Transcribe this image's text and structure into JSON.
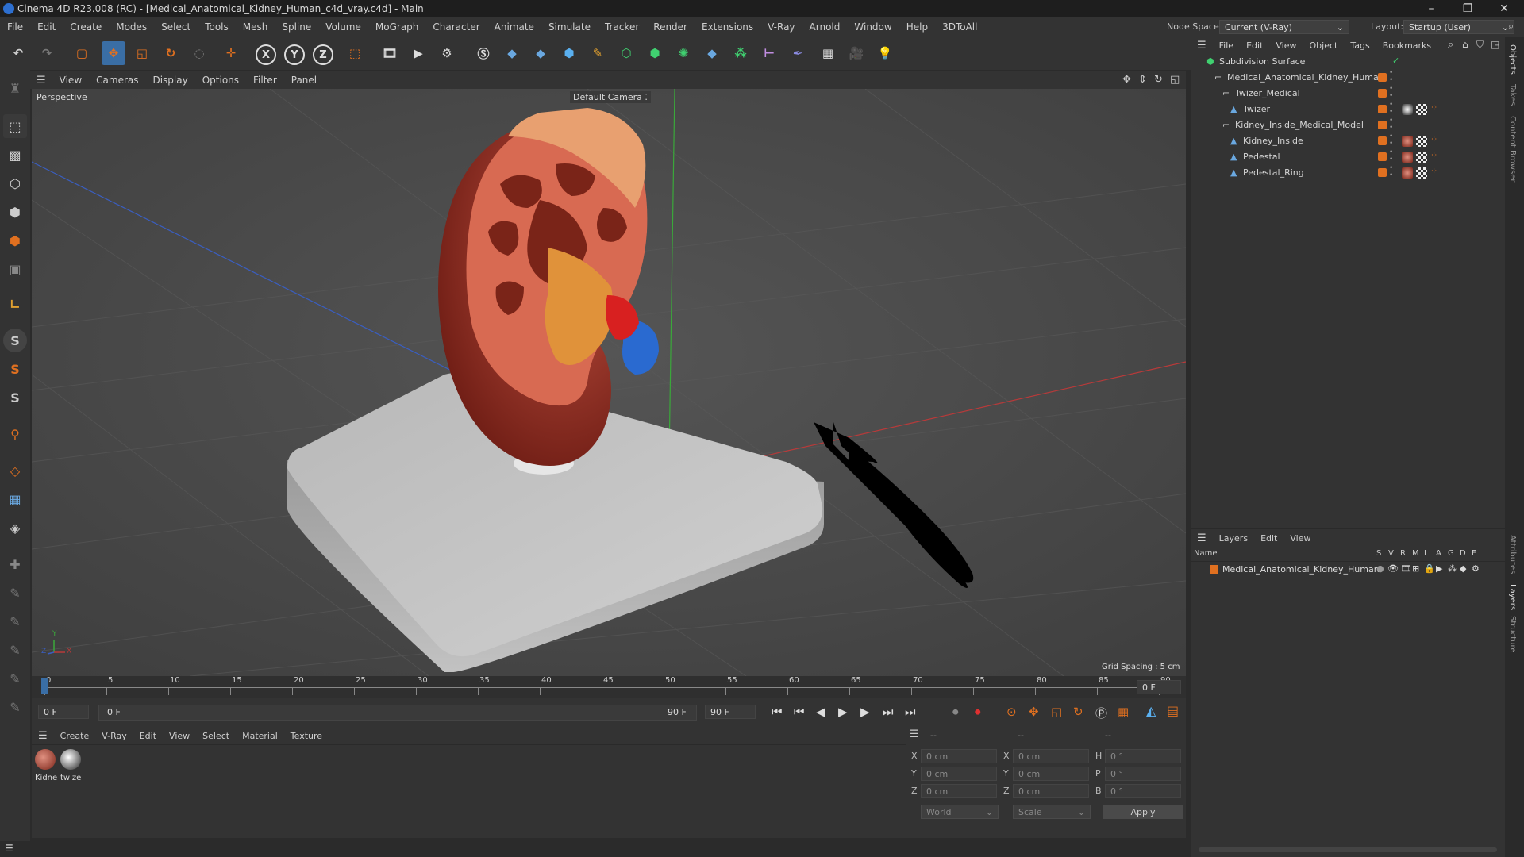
{
  "window": {
    "title": "Cinema 4D R23.008 (RC) - [Medical_Anatomical_Kidney_Human_c4d_vray.c4d] - Main",
    "controls": [
      "–",
      "❐",
      "✕"
    ]
  },
  "menubar": {
    "items": [
      "File",
      "Edit",
      "Create",
      "Modes",
      "Select",
      "Tools",
      "Mesh",
      "Spline",
      "Volume",
      "MoGraph",
      "Character",
      "Animate",
      "Simulate",
      "Tracker",
      "Render",
      "Extensions",
      "V-Ray",
      "Arnold",
      "Window",
      "Help",
      "3DToAll"
    ],
    "node_space_label": "Node Space:",
    "node_space_value": "Current (V-Ray)",
    "layout_label": "Layout:",
    "layout_value": "Startup (User)"
  },
  "viewport": {
    "menu": [
      "View",
      "Cameras",
      "Display",
      "Options",
      "Filter",
      "Panel"
    ],
    "name": "Perspective",
    "camera": "Default Camera",
    "camera_icon": "camera-dots-icon",
    "grid_spacing": "Grid Spacing : 5 cm",
    "axis_labels": {
      "x": "X",
      "y": "Y",
      "z": "Z"
    }
  },
  "timeline": {
    "ticks": [
      "0",
      "5",
      "10",
      "15",
      "20",
      "25",
      "30",
      "35",
      "40",
      "45",
      "50",
      "55",
      "60",
      "65",
      "70",
      "75",
      "80",
      "85",
      "90"
    ],
    "current_frame_box": "0 F",
    "start_field": "0 F",
    "range_start": "0 F",
    "range_end": "90 F",
    "end_field": "90 F"
  },
  "materials": {
    "menu": [
      "Create",
      "V-Ray",
      "Edit",
      "View",
      "Select",
      "Material",
      "Texture"
    ],
    "items": [
      {
        "label": "Kidne"
      },
      {
        "label": "twize"
      }
    ]
  },
  "attributes": {
    "header": [
      "--",
      "--",
      "--"
    ],
    "rows": [
      {
        "a": "X",
        "av": "0 cm",
        "b": "X",
        "bv": "0 cm",
        "c": "H",
        "cv": "0 °"
      },
      {
        "a": "Y",
        "av": "0 cm",
        "b": "Y",
        "bv": "0 cm",
        "c": "P",
        "cv": "0 °"
      },
      {
        "a": "Z",
        "av": "0 cm",
        "b": "Z",
        "bv": "0 cm",
        "c": "B",
        "cv": "0 °"
      }
    ],
    "coord_mode": "World",
    "size_mode": "Scale",
    "apply_label": "Apply"
  },
  "object_manager": {
    "menu": [
      "File",
      "Edit",
      "View",
      "Object",
      "Tags",
      "Bookmarks"
    ],
    "objects": [
      {
        "name": "Subdivision Surface",
        "depth": 0,
        "icon": "subdivision-icon",
        "color": ""
      },
      {
        "name": "Medical_Anatomical_Kidney_Human",
        "depth": 1,
        "icon": "null-object-icon",
        "color": "#e07020"
      },
      {
        "name": "Twizer_Medical",
        "depth": 2,
        "icon": "null-object-icon",
        "color": "#e07020"
      },
      {
        "name": "Twizer",
        "depth": 3,
        "icon": "polygon-object-icon",
        "color": "#e07020"
      },
      {
        "name": "Kidney_Inside_Medical_Model",
        "depth": 2,
        "icon": "null-object-icon",
        "color": "#e07020"
      },
      {
        "name": "Kidney_Inside",
        "depth": 3,
        "icon": "polygon-object-icon",
        "color": "#e07020"
      },
      {
        "name": "Pedestal",
        "depth": 3,
        "icon": "polygon-object-icon",
        "color": "#e07020"
      },
      {
        "name": "Pedestal_Ring",
        "depth": 3,
        "icon": "polygon-object-icon",
        "color": "#e07020"
      }
    ]
  },
  "layer_manager": {
    "menu": [
      "Layers",
      "Edit",
      "View"
    ],
    "columns": [
      "Name",
      "S",
      "V",
      "R",
      "M",
      "L",
      "A",
      "G",
      "D",
      "E"
    ],
    "layers": [
      {
        "name": "Medical_Anatomical_Kidney_Human",
        "color": "#e07020"
      }
    ]
  },
  "right_tabs": [
    "Objects",
    "Takes",
    "Content Browser",
    "Attributes",
    "Layers",
    "Structure"
  ],
  "colors": {
    "accent_orange": "#e07020",
    "active_blue": "#3a6ea5",
    "grid_x_axis": "#b83a3a",
    "grid_z_axis": "#3a5ec0",
    "grid_y_axis": "#3aa83a"
  }
}
